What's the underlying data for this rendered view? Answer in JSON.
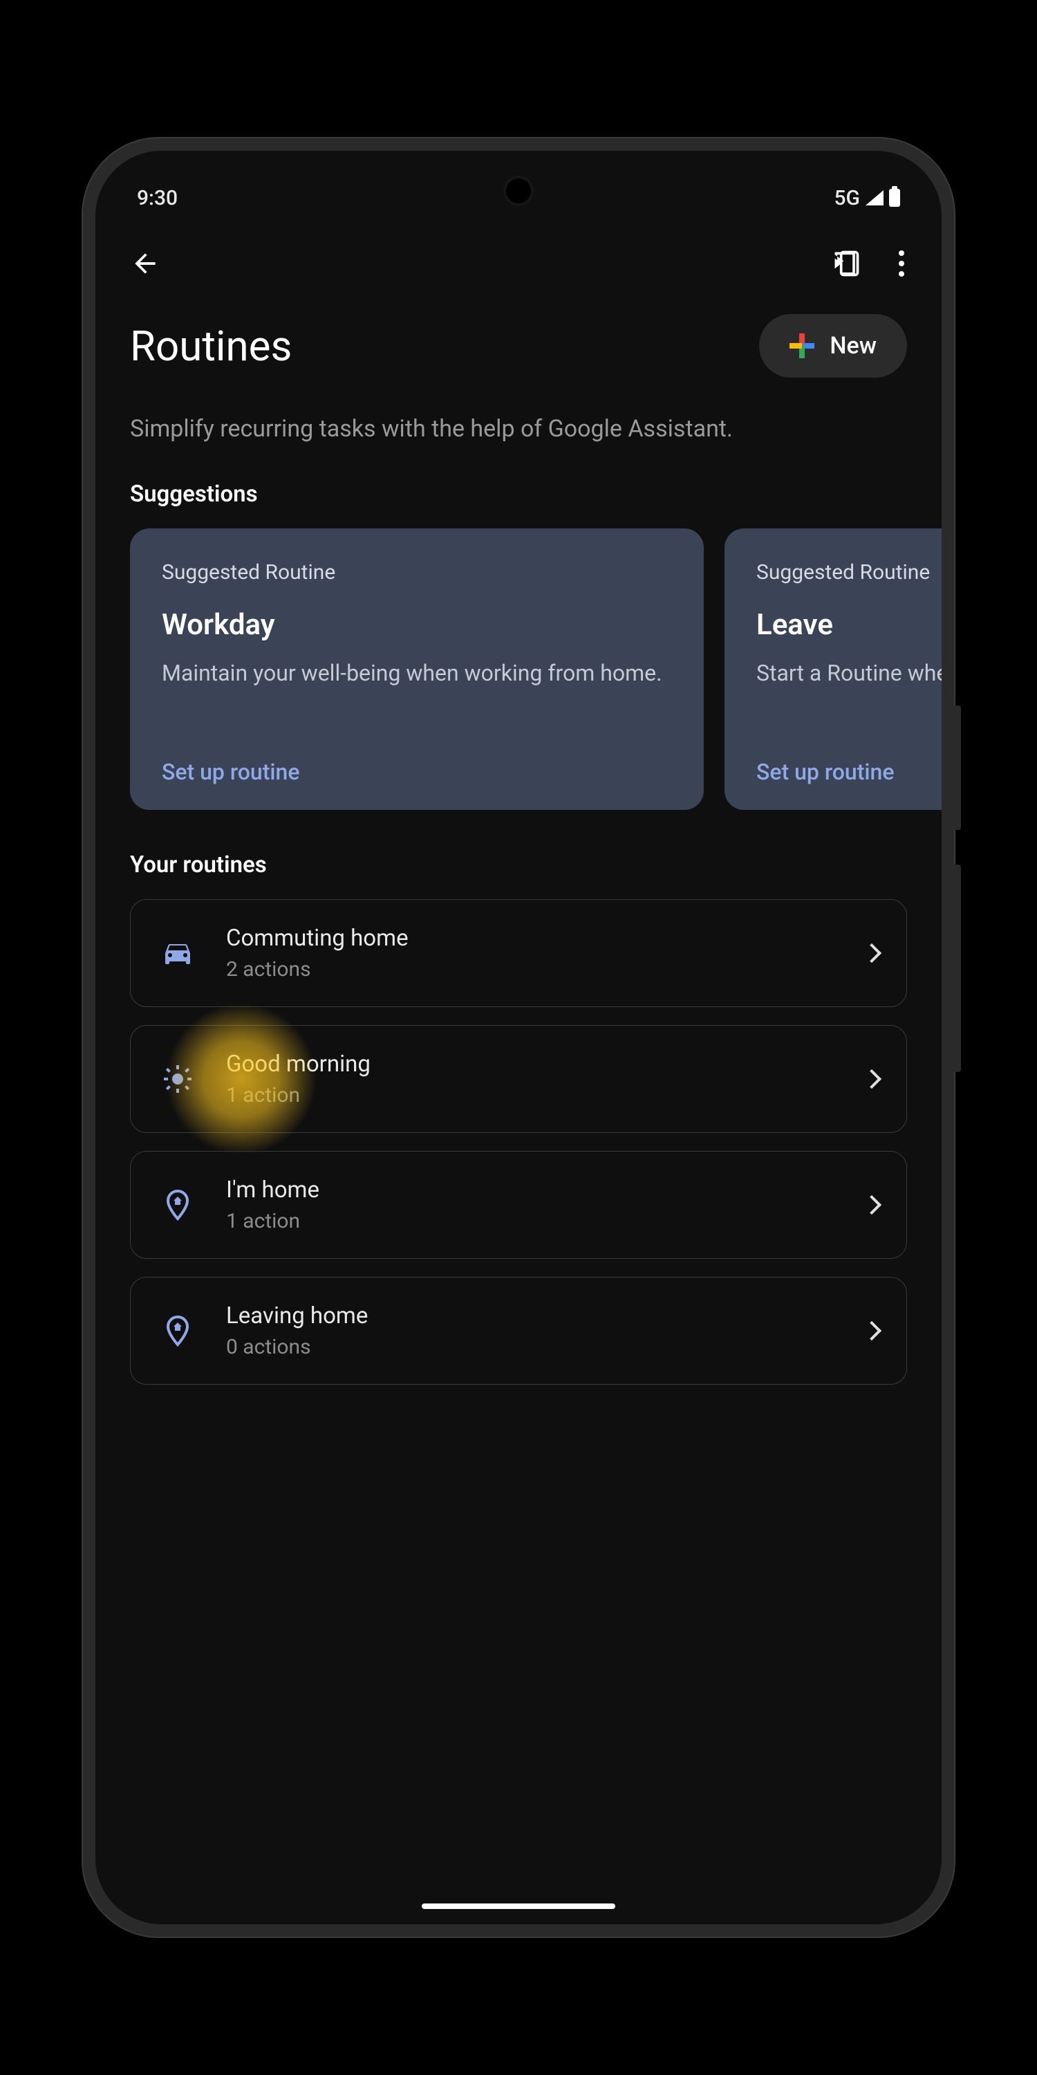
{
  "status": {
    "time": "9:30",
    "network": "5G"
  },
  "header": {
    "title": "Routines",
    "new_label": "New",
    "subtitle": "Simplify recurring tasks with the help of Google Assistant."
  },
  "sections": {
    "suggestions_label": "Suggestions",
    "your_routines_label": "Your routines"
  },
  "suggestions": [
    {
      "eyebrow": "Suggested Routine",
      "title": "Workday",
      "desc": "Maintain your well-being when working from home.",
      "cta": "Set up routine"
    },
    {
      "eyebrow": "Suggested Routine",
      "title": "Leave",
      "desc": "Start a Routine when leaving the house.",
      "cta": "Set up routine"
    }
  ],
  "routines": [
    {
      "title": "Commuting home",
      "sub": "2 actions",
      "icon": "car"
    },
    {
      "title": "Good morning",
      "sub": "1 action",
      "icon": "sun",
      "highlight": true
    },
    {
      "title": "I'm home",
      "sub": "1 action",
      "icon": "pin"
    },
    {
      "title": "Leaving home",
      "sub": "0 actions",
      "icon": "pin"
    }
  ]
}
